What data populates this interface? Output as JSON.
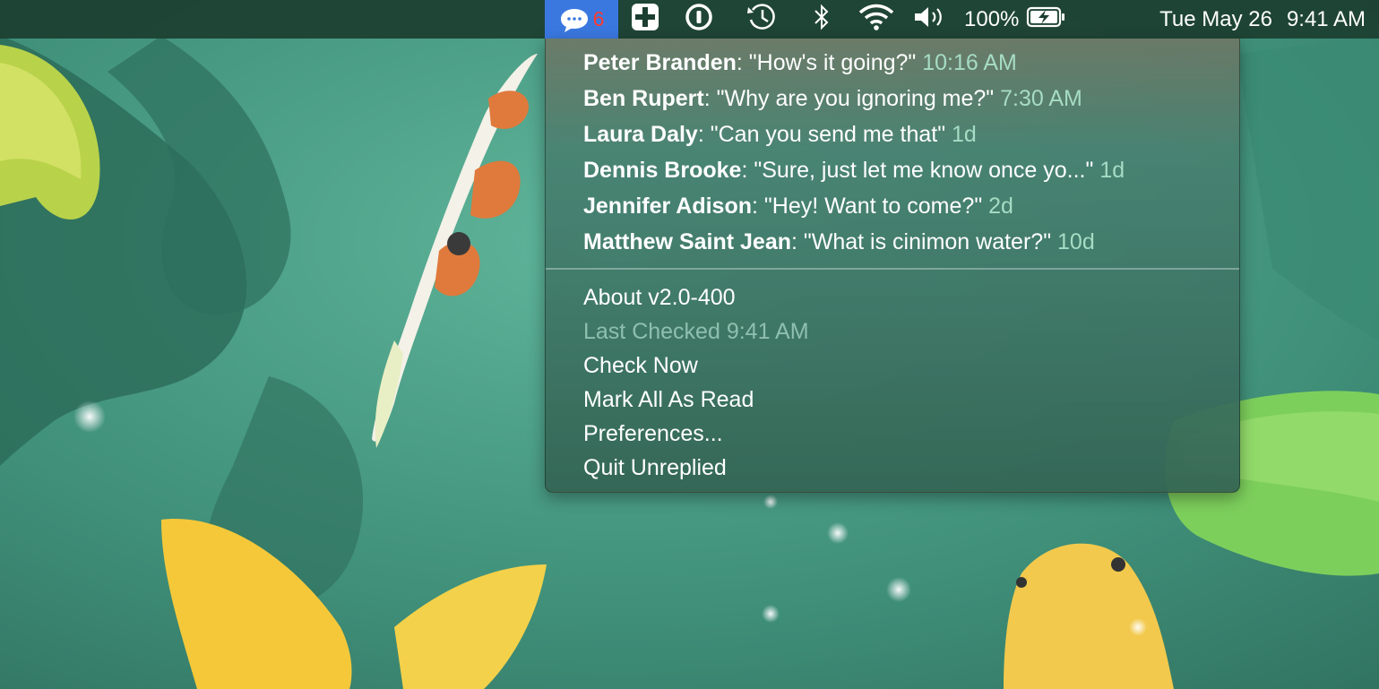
{
  "menubar": {
    "app_badge_count": "6",
    "app_icon": "speech-bubble-icon",
    "status_icons": [
      "medical-cross-icon",
      "1password-icon",
      "time-machine-icon",
      "bluetooth-icon",
      "wifi-icon",
      "volume-icon"
    ],
    "battery_percent": "100%",
    "battery_icon": "battery-charging-icon",
    "date": "Tue May 26",
    "time": "9:41 AM"
  },
  "messages": [
    {
      "name": "Peter Branden",
      "text": ": \"How's it going?\" ",
      "time": "10:16 AM"
    },
    {
      "name": "Ben Rupert",
      "text": ": \"Why are you ignoring me?\" ",
      "time": "7:30 AM"
    },
    {
      "name": "Laura Daly",
      "text": ": \"Can you send me that\" ",
      "time": "1d"
    },
    {
      "name": "Dennis Brooke",
      "text": ": \"Sure, just let me know once yo...\" ",
      "time": "1d"
    },
    {
      "name": "Jennifer Adison",
      "text": ": \"Hey! Want to come?\" ",
      "time": "2d"
    },
    {
      "name": "Matthew Saint Jean",
      "text": ": \"What is cinimon water?\" ",
      "time": "10d"
    }
  ],
  "menu_items": {
    "about": "About v2.0-400",
    "last_checked": "Last Checked 9:41 AM",
    "check_now": "Check Now",
    "mark_all_read": "Mark All As Read",
    "preferences": "Preferences...",
    "quit": "Quit Unreplied"
  },
  "colors": {
    "active_menubar_item": "#3a78e0",
    "badge": "#ff3b30",
    "timestamp": "#a6dcc4"
  }
}
